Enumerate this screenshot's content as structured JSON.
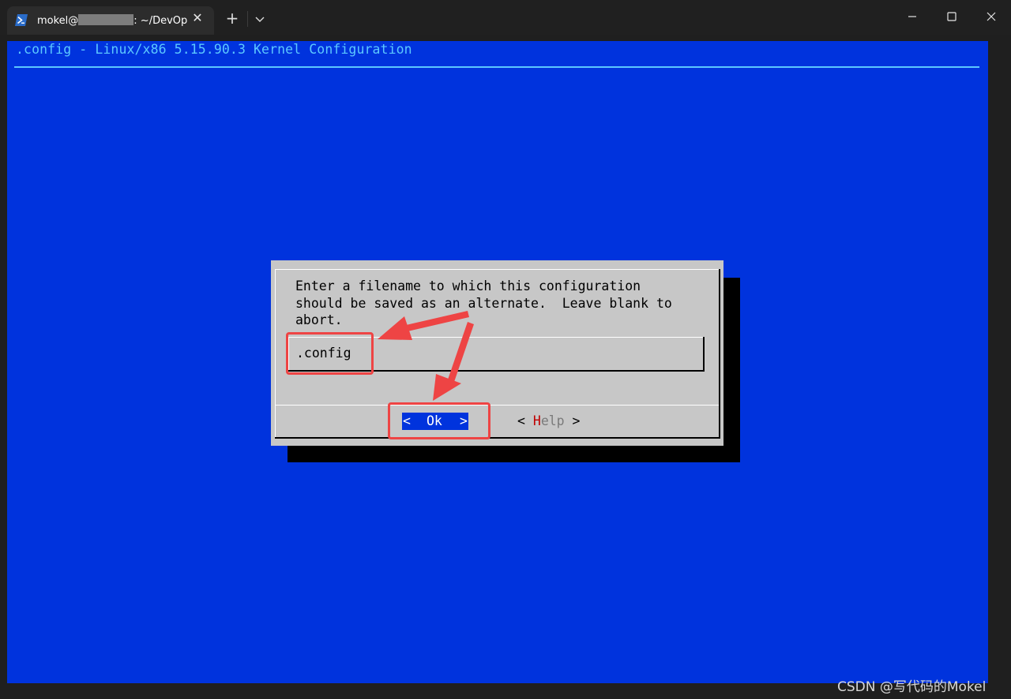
{
  "window": {
    "tab_title_prefix": "mokel@",
    "tab_title_suffix": ": ~/DevOp",
    "tab_close_glyph": "✕",
    "new_tab_glyph": "+"
  },
  "terminal": {
    "title": ".config - Linux/x86 5.15.90.3 Kernel Configuration",
    "background_color": "#0033dd",
    "title_color": "#5cc8ff"
  },
  "dialog": {
    "prompt_lines": [
      "Enter a filename to which this configuration",
      "should be saved as an alternate.  Leave blank to",
      "abort."
    ],
    "input_value": ".config",
    "ok_left": "<",
    "ok_label": "Ok",
    "ok_right": ">",
    "help_left": "< ",
    "help_hotkey": "H",
    "help_rest": "elp",
    "help_right": " >"
  },
  "annotations": {
    "color": "#ee4444"
  },
  "watermark": "CSDN @写代码的Mokel"
}
